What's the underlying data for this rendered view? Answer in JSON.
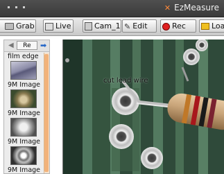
{
  "window": {
    "title": "EzMeasure",
    "icon": "app-icon"
  },
  "toolbar": {
    "grab_label": "Grab",
    "live_label": "Live",
    "cam_label": "Cam_1",
    "edit_label": "Edit",
    "rec_label": "Rec",
    "load_label": "Load",
    "rec_color": "#e02020"
  },
  "sidebar": {
    "refresh_label": "Re",
    "items": [
      {
        "label": "film edge"
      },
      {
        "label": "9M Image"
      },
      {
        "label": "9M Image"
      },
      {
        "label": "9M Image"
      },
      {
        "label": "9M Image"
      }
    ],
    "scrollbar_color": "#f2b27a"
  },
  "viewer": {
    "annotation_text": "cut lead wire"
  }
}
